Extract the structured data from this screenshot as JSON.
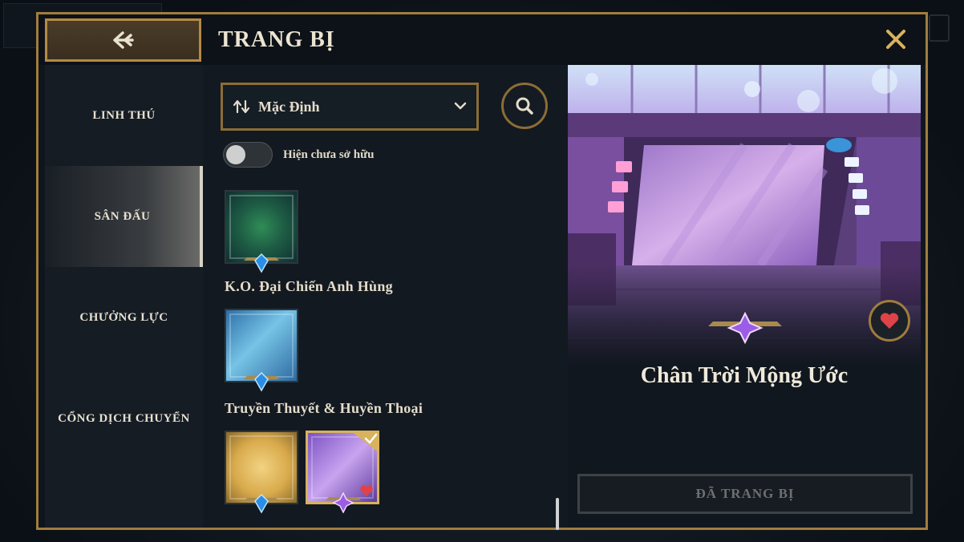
{
  "header": {
    "title": "TRANG BỊ",
    "back_icon": "back-arrow-icon",
    "close_icon": "close-icon"
  },
  "sidebar": {
    "items": [
      {
        "label": "LINH THÚ",
        "active": false
      },
      {
        "label": "SÂN ĐẤU",
        "active": true
      },
      {
        "label": "CHƯỞNG LỰC",
        "active": false
      },
      {
        "label": "CỔNG DỊCH CHUYỂN",
        "active": false
      }
    ]
  },
  "filters": {
    "sort_label": "Mặc Định",
    "sort_icon": "sort-arrows-icon",
    "search_icon": "search-icon",
    "show_unowned_label": "Hiện chưa sở hữu",
    "show_unowned_on": false
  },
  "collections": [
    {
      "title": "",
      "items": [
        {
          "theme": "green"
        }
      ]
    },
    {
      "title": "K.O. Đại Chiến Anh Hùng",
      "items": [
        {
          "theme": "blue"
        }
      ]
    },
    {
      "title": "Truyền Thuyết & Huyền Thoại",
      "items": [
        {
          "theme": "gold"
        },
        {
          "theme": "purple",
          "equipped": true,
          "favorite": true
        }
      ]
    }
  ],
  "preview": {
    "name": "Chân Trời Mộng Ước",
    "favorite_icon": "heart-icon",
    "equip_button_label": "ĐÃ TRANG BỊ"
  },
  "colors": {
    "accent_gold": "#a17d3e",
    "gem_blue": "#2a8ee6",
    "gem_purple": "#9b5de5",
    "heart_red": "#e0424a"
  }
}
